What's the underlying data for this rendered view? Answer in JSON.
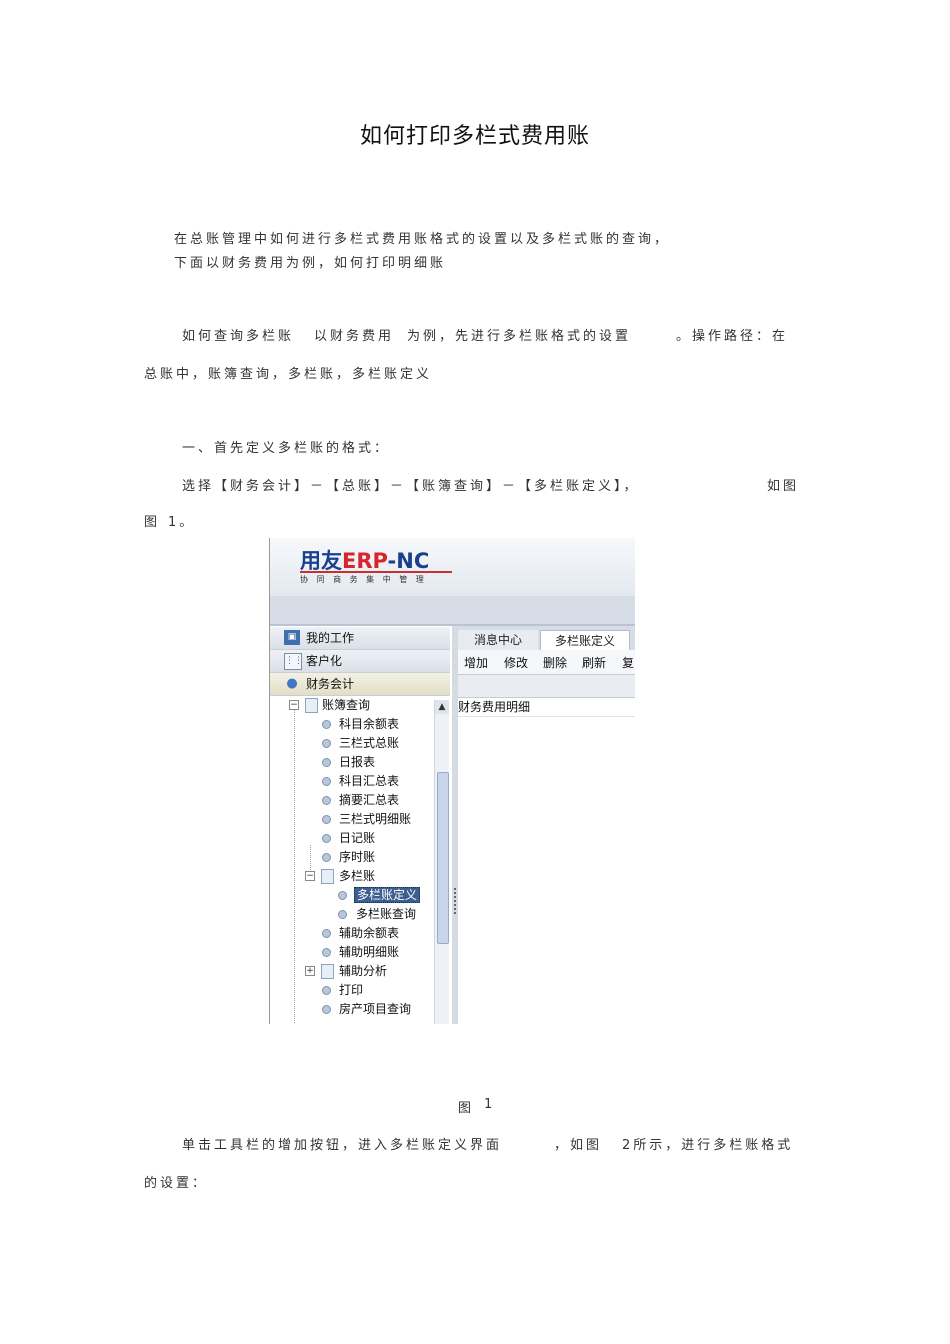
{
  "title": "如何打印多栏式费用账",
  "para1": {
    "line1": "在总账管理中如何进行多栏式费用账格式的设置以及多栏式账的查询，",
    "line2": "下面以财务费用为例，如何打印明细账"
  },
  "para2": {
    "seg1": "如何查询多栏账",
    "seg2": "以财务费用",
    "seg3": "为例，先进行多栏账格式的设置",
    "seg4": "。",
    "seg5": "操作路径：在",
    "line2": "总账中，账簿查询，多栏账，多栏账定义"
  },
  "para3": "一、首先定义多栏账的格式：",
  "para4": {
    "seg1": "选择【财务会计】－【总账】－【账簿查询】－【多栏账定义】，",
    "seg2": "如图",
    "line2_a": "图",
    "line2_b": "1。"
  },
  "figure": {
    "logo": {
      "brand": "用友",
      "erp": "ERP",
      "suffix": "-NC",
      "tagline": "协 同 商 务   集 中 管 理"
    },
    "nav": [
      {
        "icon": "monitor-icon",
        "label": "我的工作"
      },
      {
        "icon": "grid-icon",
        "label": "客户化"
      },
      {
        "icon": "users-icon",
        "label": "财务会计"
      }
    ],
    "tree": {
      "root": "账簿查询",
      "items": [
        "科目余额表",
        "三栏式总账",
        "日报表",
        "科目汇总表",
        "摘要汇总表",
        "三栏式明细账",
        "日记账",
        "序时账"
      ],
      "folder": "多栏账",
      "children": [
        "多栏账定义",
        "多栏账查询"
      ],
      "items2": [
        "辅助余额表",
        "辅助明细账"
      ],
      "folder2": "辅助分析",
      "items3": [
        "打印",
        "房产项目查询"
      ]
    },
    "tabs": [
      "消息中心",
      "多栏账定义"
    ],
    "toolbar": [
      "增加",
      "修改",
      "删除",
      "刷新",
      "复"
    ],
    "row": "财务费用明细"
  },
  "caption": {
    "label": "图",
    "num": "1"
  },
  "para5": {
    "seg1": "单击工具栏的增加按钮，进入多栏账定义界面",
    "seg2": "，如图",
    "seg3": "2所示，进行多栏账格式",
    "line2": "的设置："
  }
}
